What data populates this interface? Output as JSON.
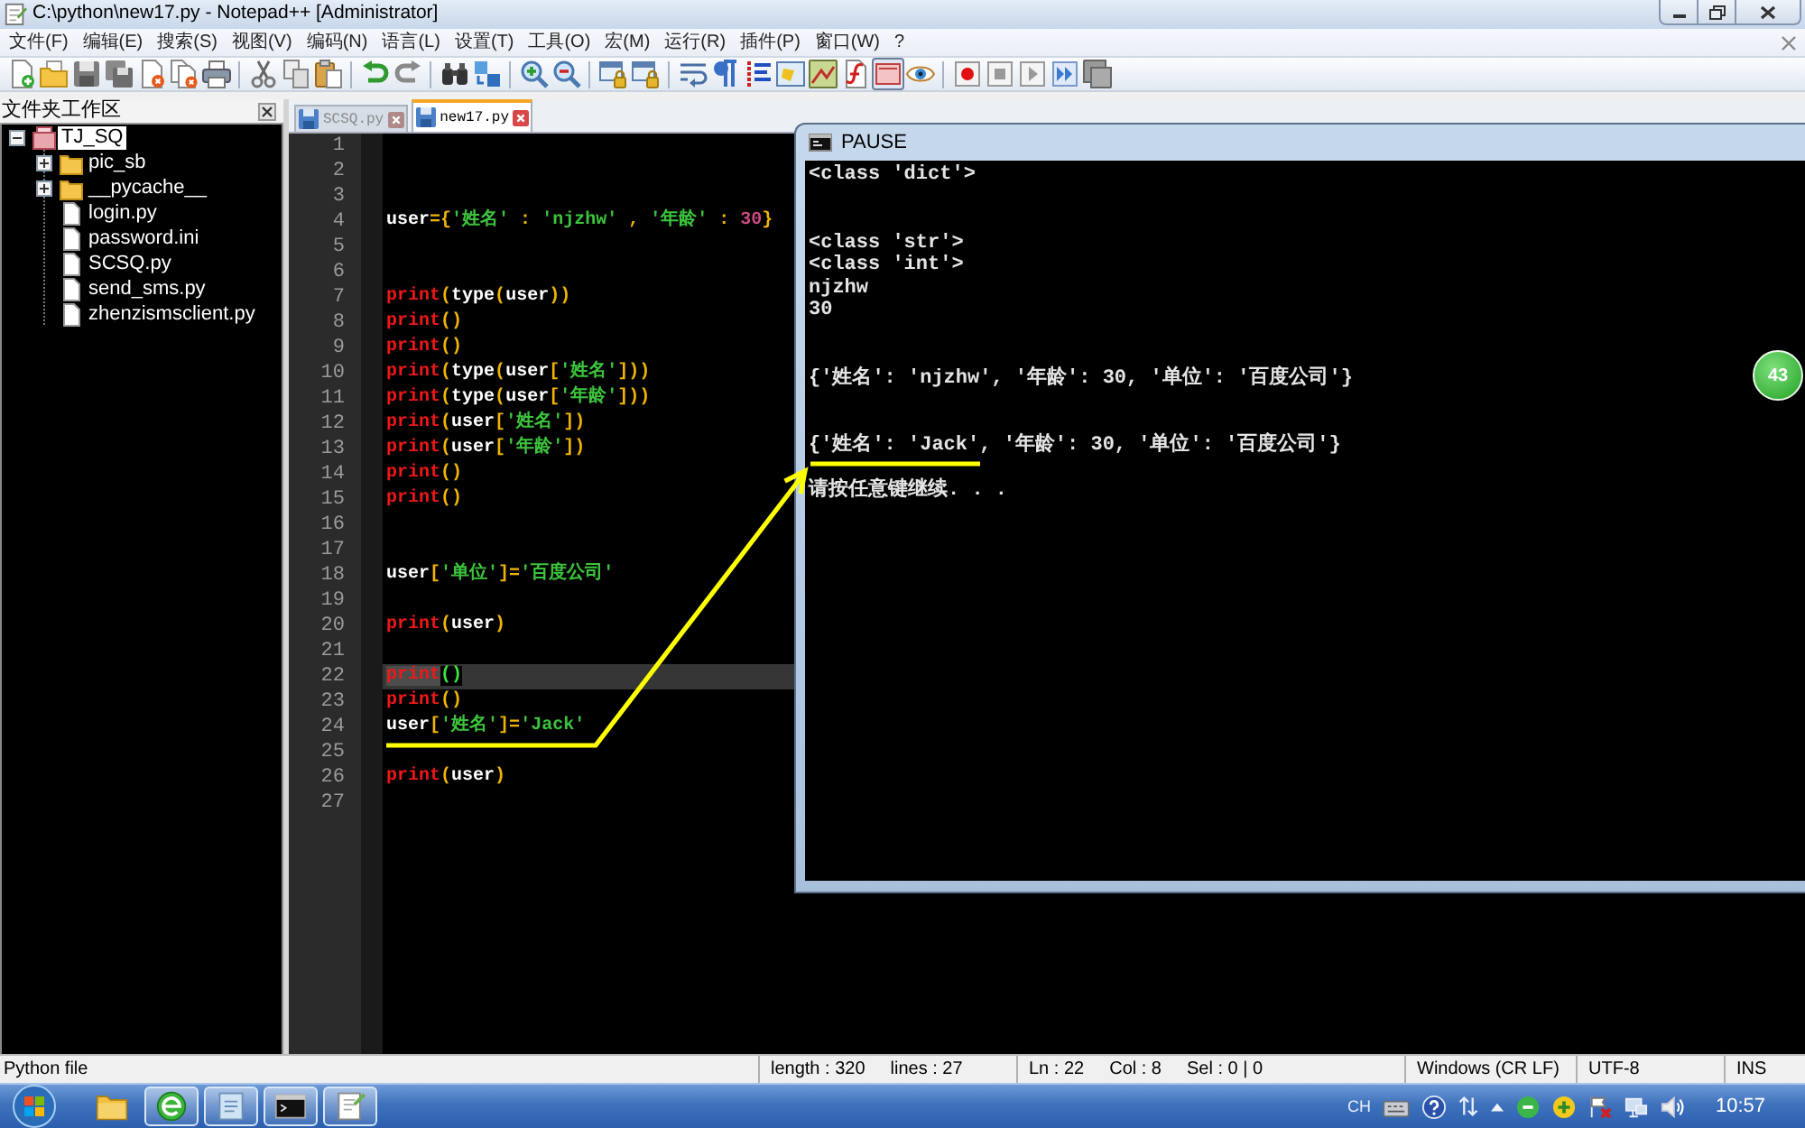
{
  "window": {
    "title": "C:\\python\\new17.py - Notepad++ [Administrator]"
  },
  "menu": {
    "items": [
      "文件(F)",
      "编辑(E)",
      "搜索(S)",
      "视图(V)",
      "编码(N)",
      "语言(L)",
      "设置(T)",
      "工具(O)",
      "宏(M)",
      "运行(R)",
      "插件(P)",
      "窗口(W)",
      "?"
    ]
  },
  "toolbar": {
    "groups": [
      [
        {
          "kind": "new",
          "pressed": false
        },
        {
          "kind": "open",
          "pressed": false
        },
        {
          "kind": "save",
          "pressed": false
        },
        {
          "kind": "save_all",
          "pressed": false
        },
        {
          "kind": "close",
          "pressed": false
        },
        {
          "kind": "close_all",
          "pressed": false
        },
        {
          "kind": "print",
          "pressed": false
        }
      ],
      [
        {
          "kind": "cut",
          "pressed": false
        },
        {
          "kind": "copy",
          "pressed": false
        },
        {
          "kind": "paste",
          "pressed": false
        }
      ],
      [
        {
          "kind": "undo",
          "pressed": false
        },
        {
          "kind": "redo",
          "pressed": false
        }
      ],
      [
        {
          "kind": "find",
          "pressed": false
        },
        {
          "kind": "replace",
          "pressed": false
        }
      ],
      [
        {
          "kind": "zoom_in",
          "pressed": false
        },
        {
          "kind": "zoom_out",
          "pressed": false
        }
      ],
      [
        {
          "kind": "sync_v",
          "pressed": false
        },
        {
          "kind": "sync_h",
          "pressed": false
        }
      ],
      [
        {
          "kind": "wrap",
          "pressed": false
        },
        {
          "kind": "all_chars",
          "pressed": false
        },
        {
          "kind": "indent_guide",
          "pressed": false
        },
        {
          "kind": "udl",
          "pressed": false
        },
        {
          "kind": "doc_map",
          "pressed": false
        },
        {
          "kind": "func_list",
          "pressed": false
        },
        {
          "kind": "folder_ws",
          "pressed": true
        },
        {
          "kind": "monitor",
          "pressed": false
        }
      ],
      [
        {
          "kind": "record",
          "pressed": false
        },
        {
          "kind": "stop",
          "pressed": false
        },
        {
          "kind": "play",
          "pressed": false
        },
        {
          "kind": "play_multi",
          "pressed": false
        },
        {
          "kind": "save_macro",
          "pressed": false
        }
      ]
    ]
  },
  "sidebar": {
    "title": "文件夹工作区",
    "tree": [
      {
        "label": "TJ_SQ",
        "kind": "project",
        "expanded": true,
        "selected": true,
        "children": [
          {
            "label": "pic_sb",
            "kind": "folder",
            "expanded": false,
            "selected": false
          },
          {
            "label": "__pycache__",
            "kind": "folder",
            "expanded": false,
            "selected": false
          },
          {
            "label": "login.py",
            "kind": "file",
            "selected": false
          },
          {
            "label": "password.ini",
            "kind": "file",
            "selected": false
          },
          {
            "label": "SCSQ.py",
            "kind": "file",
            "selected": false
          },
          {
            "label": "send_sms.py",
            "kind": "file",
            "selected": false
          },
          {
            "label": "zhenzismsclient.py",
            "kind": "file",
            "selected": false
          }
        ]
      }
    ]
  },
  "tabs": [
    {
      "label": "SCSQ.py",
      "selected": false
    },
    {
      "label": "new17.py",
      "selected": true
    }
  ],
  "editor": {
    "lines": [
      {
        "number": "1",
        "current": false
      },
      {
        "number": "2",
        "current": false
      },
      {
        "number": "3",
        "current": false
      },
      {
        "number": "4",
        "current": false,
        "tokens": [
          {
            "kind": "identifier",
            "text": "user"
          },
          {
            "kind": "operator",
            "text": "={"
          },
          {
            "kind": "string",
            "text": "'姓名'"
          },
          {
            "kind": "operator",
            "text": " : "
          },
          {
            "kind": "string",
            "text": "'njzhw'"
          },
          {
            "kind": "operator",
            "text": " , "
          },
          {
            "kind": "string",
            "text": "'年龄'"
          },
          {
            "kind": "operator",
            "text": " : "
          },
          {
            "kind": "number",
            "text": "30"
          },
          {
            "kind": "operator",
            "text": "}"
          }
        ]
      },
      {
        "number": "5",
        "current": false
      },
      {
        "number": "6",
        "current": false
      },
      {
        "number": "7",
        "current": false,
        "tokens": [
          {
            "kind": "keyword",
            "text": "print"
          },
          {
            "kind": "operator",
            "text": "("
          },
          {
            "kind": "identifier",
            "text": "type"
          },
          {
            "kind": "operator",
            "text": "("
          },
          {
            "kind": "identifier",
            "text": "user"
          },
          {
            "kind": "operator",
            "text": "))"
          }
        ]
      },
      {
        "number": "8",
        "current": false,
        "tokens": [
          {
            "kind": "keyword",
            "text": "print"
          },
          {
            "kind": "operator",
            "text": "()"
          }
        ]
      },
      {
        "number": "9",
        "current": false,
        "tokens": [
          {
            "kind": "keyword",
            "text": "print"
          },
          {
            "kind": "operator",
            "text": "()"
          }
        ]
      },
      {
        "number": "10",
        "current": false,
        "tokens": [
          {
            "kind": "keyword",
            "text": "print"
          },
          {
            "kind": "operator",
            "text": "("
          },
          {
            "kind": "identifier",
            "text": "type"
          },
          {
            "kind": "operator",
            "text": "("
          },
          {
            "kind": "identifier",
            "text": "user"
          },
          {
            "kind": "operator",
            "text": "["
          },
          {
            "kind": "string",
            "text": "'姓名'"
          },
          {
            "kind": "operator",
            "text": "]))"
          }
        ]
      },
      {
        "number": "11",
        "current": false,
        "tokens": [
          {
            "kind": "keyword",
            "text": "print"
          },
          {
            "kind": "operator",
            "text": "("
          },
          {
            "kind": "identifier",
            "text": "type"
          },
          {
            "kind": "operator",
            "text": "("
          },
          {
            "kind": "identifier",
            "text": "user"
          },
          {
            "kind": "operator",
            "text": "["
          },
          {
            "kind": "string",
            "text": "'年龄'"
          },
          {
            "kind": "operator",
            "text": "]))"
          }
        ]
      },
      {
        "number": "12",
        "current": false,
        "tokens": [
          {
            "kind": "keyword",
            "text": "print"
          },
          {
            "kind": "operator",
            "text": "("
          },
          {
            "kind": "identifier",
            "text": "user"
          },
          {
            "kind": "operator",
            "text": "["
          },
          {
            "kind": "string",
            "text": "'姓名'"
          },
          {
            "kind": "operator",
            "text": "])"
          }
        ]
      },
      {
        "number": "13",
        "current": false,
        "tokens": [
          {
            "kind": "keyword",
            "text": "print"
          },
          {
            "kind": "operator",
            "text": "("
          },
          {
            "kind": "identifier",
            "text": "user"
          },
          {
            "kind": "operator",
            "text": "["
          },
          {
            "kind": "string",
            "text": "'年龄'"
          },
          {
            "kind": "operator",
            "text": "])"
          }
        ]
      },
      {
        "number": "14",
        "current": false,
        "tokens": [
          {
            "kind": "keyword",
            "text": "print"
          },
          {
            "kind": "operator",
            "text": "()"
          }
        ]
      },
      {
        "number": "15",
        "current": false,
        "tokens": [
          {
            "kind": "keyword",
            "text": "print"
          },
          {
            "kind": "operator",
            "text": "()"
          }
        ]
      },
      {
        "number": "16",
        "current": false
      },
      {
        "number": "17",
        "current": false
      },
      {
        "number": "18",
        "current": false,
        "tokens": [
          {
            "kind": "identifier",
            "text": "user"
          },
          {
            "kind": "operator",
            "text": "["
          },
          {
            "kind": "string",
            "text": "'单位'"
          },
          {
            "kind": "operator",
            "text": "]="
          },
          {
            "kind": "string",
            "text": "'百度公司'"
          }
        ]
      },
      {
        "number": "19",
        "current": false
      },
      {
        "number": "20",
        "current": false,
        "tokens": [
          {
            "kind": "keyword",
            "text": "print"
          },
          {
            "kind": "operator",
            "text": "("
          },
          {
            "kind": "identifier",
            "text": "user"
          },
          {
            "kind": "operator",
            "text": ")"
          }
        ]
      },
      {
        "number": "21",
        "current": false
      },
      {
        "number": "22",
        "current": true,
        "tokens": [
          {
            "kind": "marked_keyword",
            "text": "print"
          },
          {
            "kind": "brace_match",
            "text": "()"
          }
        ]
      },
      {
        "number": "23",
        "current": false,
        "tokens": [
          {
            "kind": "keyword",
            "text": "print"
          },
          {
            "kind": "operator",
            "text": "()"
          }
        ]
      },
      {
        "number": "24",
        "current": false,
        "tokens": [
          {
            "kind": "identifier",
            "text": "user"
          },
          {
            "kind": "operator",
            "text": "["
          },
          {
            "kind": "string",
            "text": "'姓名'"
          },
          {
            "kind": "operator",
            "text": "]="
          },
          {
            "kind": "string",
            "text": "'Jack'"
          }
        ]
      },
      {
        "number": "25",
        "current": false
      },
      {
        "number": "26",
        "current": false,
        "tokens": [
          {
            "kind": "keyword",
            "text": "print"
          },
          {
            "kind": "operator",
            "text": "("
          },
          {
            "kind": "identifier",
            "text": "user"
          },
          {
            "kind": "operator",
            "text": ")"
          }
        ]
      },
      {
        "number": "27",
        "current": false
      }
    ]
  },
  "console": {
    "title": "PAUSE",
    "lines": [
      {
        "kind": "text",
        "text": "<class 'dict'>"
      },
      {
        "kind": "blank"
      },
      {
        "kind": "blank"
      },
      {
        "kind": "text",
        "text": "<class 'str'>"
      },
      {
        "kind": "text",
        "text": "<class 'int'>"
      },
      {
        "kind": "text",
        "text": "njzhw"
      },
      {
        "kind": "text",
        "text": "30"
      },
      {
        "kind": "blank"
      },
      {
        "kind": "blank"
      },
      {
        "kind": "text",
        "text": "{'姓名': 'njzhw', '年龄': 30, '单位': '百度公司'}"
      },
      {
        "kind": "blank"
      },
      {
        "kind": "blank"
      },
      {
        "kind": "text",
        "text": "{'姓名': 'Jack', '年龄': 30, '单位': '百度公司'}"
      },
      {
        "kind": "blank"
      },
      {
        "kind": "text",
        "text": "请按任意键继续. . ."
      }
    ]
  },
  "floating_badge": {
    "text": "43"
  },
  "status_bar": {
    "sections": [
      [
        "Python file"
      ],
      [
        "length : 320",
        "lines : 27"
      ],
      [
        "Ln : 22",
        "Col : 8",
        "Sel : 0 | 0"
      ],
      [
        "Windows (CR LF)"
      ],
      [
        "UTF-8"
      ],
      [
        "INS"
      ]
    ]
  },
  "taskbar": {
    "apps": [
      {
        "kind": "folder",
        "running": false
      },
      {
        "kind": "browser",
        "running": true
      },
      {
        "kind": "notepad",
        "running": true
      },
      {
        "kind": "terminal",
        "running": true
      },
      {
        "kind": "notepadpp",
        "running": true
      }
    ],
    "tray": {
      "language": "CH",
      "clock": "10:57"
    }
  }
}
